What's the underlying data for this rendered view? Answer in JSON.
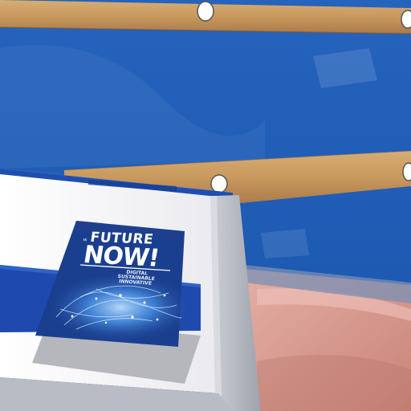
{
  "poster": {
    "headline_top": "FUTURE",
    "headline_small": "IS",
    "headline_main": "NOW!",
    "tagline_1": "DIGITAL",
    "tagline_2": "SUSTAINABLE",
    "tagline_3": "INNOVATIVE"
  },
  "colors": {
    "wall_blue": "#1f5cb4",
    "wood": "#c89b62",
    "sofa_pink": "#d99a92",
    "poster_navy": "#1b3f8f",
    "panel_white": "#f4f4f6"
  }
}
